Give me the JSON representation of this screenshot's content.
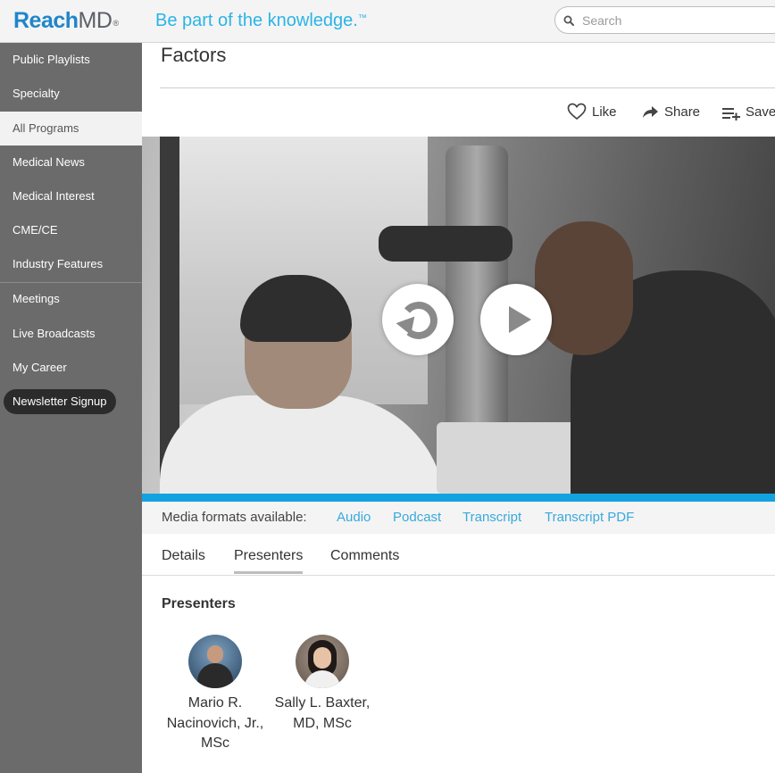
{
  "header": {
    "logo_reach": "Reach",
    "logo_md": "MD",
    "logo_tm": "®",
    "tagline": "Be part of the knowledge.",
    "tagline_tm": "™",
    "search_placeholder": "Search"
  },
  "sidebar": {
    "items": [
      {
        "label": "Public Playlists"
      },
      {
        "label": "Specialty"
      },
      {
        "label": "All Programs"
      },
      {
        "label": "Medical News"
      },
      {
        "label": "Medical Interest"
      },
      {
        "label": "CME/CE"
      },
      {
        "label": "Industry Features"
      },
      {
        "label": "Meetings"
      },
      {
        "label": "Live Broadcasts"
      },
      {
        "label": "My Career"
      }
    ],
    "active_item": "All Programs",
    "newsletter": "Newsletter Signup"
  },
  "main": {
    "title": "Factors",
    "actions": {
      "like": "Like",
      "share": "Share",
      "save": "Save"
    },
    "media_formats": {
      "label": "Media formats available:",
      "links": [
        "Audio",
        "Podcast",
        "Transcript",
        "Transcript PDF"
      ]
    },
    "tabs": [
      {
        "label": "Details"
      },
      {
        "label": "Presenters"
      },
      {
        "label": "Comments"
      }
    ],
    "active_tab": "Presenters",
    "presenters_heading": "Presenters",
    "presenters": [
      {
        "name": "Mario R. Nacinovich, Jr., MSc"
      },
      {
        "name": "Sally L. Baxter, MD, MSc"
      }
    ]
  },
  "colors": {
    "brand_blue": "#1f86c9",
    "tagline_blue": "#2bb4e6",
    "link_blue": "#39a9dd",
    "progress_blue": "#13a2e0",
    "sidebar_gray": "#6b6b6b"
  }
}
